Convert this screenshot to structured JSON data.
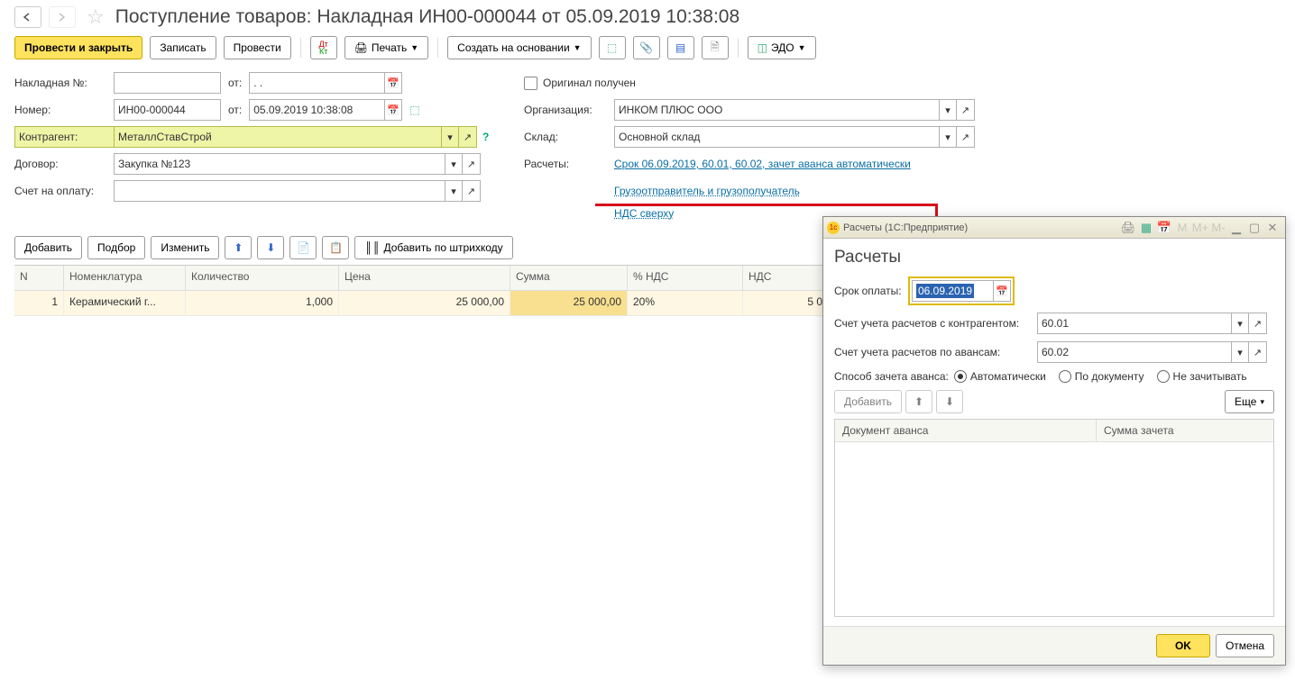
{
  "title": "Поступление товаров: Накладная ИН00-000044 от 05.09.2019 10:38:08",
  "toolbar": {
    "post_close": "Провести и закрыть",
    "save": "Записать",
    "post": "Провести",
    "print": "Печать",
    "create_based": "Создать на основании",
    "edo": "ЭДО"
  },
  "form": {
    "invoice_no_label": "Накладная №:",
    "invoice_no_value": "",
    "from_label": "от:",
    "invoice_date_value": ". .",
    "number_label": "Номер:",
    "number_value": "ИН00-000044",
    "date_value": "05.09.2019 10:38:08",
    "counterparty_label": "Контрагент:",
    "counterparty_value": "МеталлСтавСтрой",
    "contract_label": "Договор:",
    "contract_value": "Закупка №123",
    "invoice_payment_label": "Счет на оплату:",
    "original_received": "Оригинал получен",
    "org_label": "Организация:",
    "org_value": "ИНКОМ ПЛЮС ООО",
    "warehouse_label": "Склад:",
    "warehouse_value": "Основной склад",
    "settlements_label": "Расчеты:",
    "settlements_link": "Срок 06.09.2019, 60.01, 60.02, зачет аванса автоматически",
    "shipper_link": "Грузоотправитель и грузополучатель",
    "vat_link": "НДС сверху"
  },
  "table_toolbar": {
    "add": "Добавить",
    "select": "Подбор",
    "edit": "Изменить",
    "barcode": "Добавить по штрихкоду"
  },
  "columns": {
    "n": "N",
    "nomenclature": "Номенклатура",
    "qty": "Количество",
    "price": "Цена",
    "sum": "Сумма",
    "vat_rate": "% НДС",
    "vat": "НДС"
  },
  "rows": [
    {
      "n": "1",
      "nom": "Керамический г...",
      "qty": "1,000",
      "price": "25 000,00",
      "sum": "25 000,00",
      "vat_rate": "20%",
      "vat": "5 0"
    }
  ],
  "modal": {
    "title": "Расчеты  (1С:Предприятие)",
    "heading": "Расчеты",
    "due_label": "Срок оплаты:",
    "due_value": "06.09.2019",
    "acc_settlements_label": "Счет учета расчетов с контрагентом:",
    "acc_settlements_value": "60.01",
    "acc_advance_label": "Счет учета расчетов по авансам:",
    "acc_advance_value": "60.02",
    "advance_method_label": "Способ зачета аванса:",
    "opt_auto": "Автоматически",
    "opt_doc": "По документу",
    "opt_none": "Не зачитывать",
    "add": "Добавить",
    "more": "Еще",
    "col_doc": "Документ аванса",
    "col_sum": "Сумма зачета",
    "ok": "OK",
    "cancel": "Отмена",
    "title_m": "M",
    "title_mp": "M+",
    "title_mm": "M-"
  }
}
